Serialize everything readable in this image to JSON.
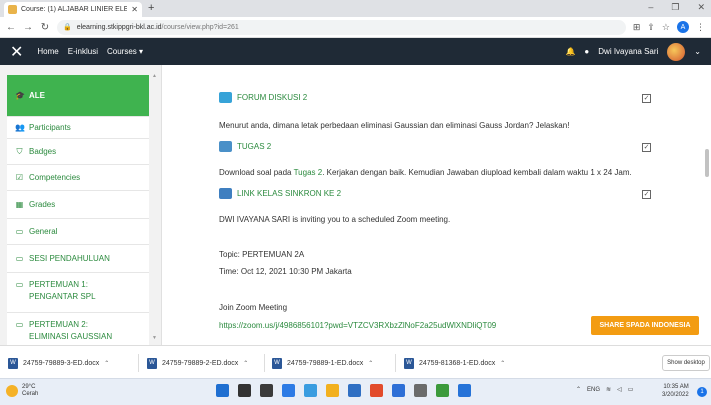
{
  "browser": {
    "tab_title": "Course: (1) ALJABAR LINIER ELEM",
    "tab_close": "✕",
    "new_tab": "+",
    "url_host": "elearning.stkippgri-bkl.ac.id",
    "url_path": "/course/view.php?id=261"
  },
  "navbar": {
    "close_glyph": "✕",
    "links": [
      "Home",
      "E-inklusi",
      "Courses ▾"
    ],
    "user_name": "Dwi Ivayana Sari"
  },
  "sidebar": {
    "items": [
      {
        "label": "ALE",
        "icon": "graduation-cap-icon",
        "glyph": "🎓",
        "active": true
      },
      {
        "label": "Participants",
        "icon": "users-icon",
        "glyph": "👥"
      },
      {
        "label": "Badges",
        "icon": "shield-icon",
        "glyph": "⛉"
      },
      {
        "label": "Competencies",
        "icon": "check-square-icon",
        "glyph": "☑"
      },
      {
        "label": "Grades",
        "icon": "table-icon",
        "glyph": "▦"
      },
      {
        "label": "General",
        "icon": "folder-icon",
        "glyph": "▭"
      },
      {
        "label": "SESI PENDAHULUAN",
        "icon": "folder-icon",
        "glyph": "▭"
      },
      {
        "label": "PERTEMUAN 1: PENGANTAR SPL",
        "icon": "folder-icon",
        "glyph": "▭"
      },
      {
        "label": "PERTEMUAN 2: ELIMINASI GAUSSIAN",
        "icon": "folder-icon",
        "glyph": "▭"
      }
    ]
  },
  "main": {
    "forum_title": "FORUM DISKUSI 2",
    "forum_text": "Menurut anda, dimana letak perbedaan eliminasi Gaussian dan eliminasi Gauss Jordan? Jelaskan!",
    "tugas_title": "TUGAS 2",
    "tugas_text_before": "Download soal pada ",
    "tugas_link": "Tugas 2",
    "tugas_text_after": ". Kerjakan dengan baik. Kemudian Jawaban diupload kembali dalam waktu 1 x 24 Jam.",
    "link_title": "LINK KELAS SINKRON KE 2",
    "zoom_invite": "DWI IVAYANA SARI is inviting you to a scheduled Zoom meeting.",
    "topic": "Topic: PERTEMUAN 2A",
    "time": "Time: Oct 12, 2021 10:30 PM Jakarta",
    "join": "Join Zoom Meeting",
    "zoom_url": "https://zoom.us/j/4986856101?pwd=VTZCV3RXbzZlNoF2a25udWlXNDliQT09",
    "spada_button": "SHARE SPADA INDONESIA",
    "check_glyph": "✓"
  },
  "downloads": {
    "files": [
      "24759-79889-3-ED.docx",
      "24759-79889-2-ED.docx",
      "24759-79889-1-ED.docx",
      "24759-81368-1-ED.docx"
    ],
    "show_all": "Show desktop"
  },
  "taskbar": {
    "temperature": "29°C",
    "weather": "Cerah",
    "language": "ENG",
    "time": "10:35 AM",
    "date": "3/20/2022",
    "notifications": "1",
    "app_colors": [
      "#1f6fd1",
      "#333333",
      "#3b3b3b",
      "#2d7be5",
      "#3a9de0",
      "#f2b01e",
      "#2f6fc3",
      "#e24b2b",
      "#2e6fd6",
      "#6b6b6b",
      "#3c9a3c",
      "#2673d8"
    ]
  }
}
